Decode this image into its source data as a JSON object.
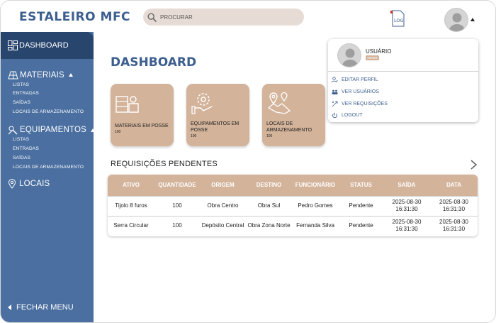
{
  "header": {
    "app_title": "ESTALEIRO MFC",
    "search_placeholder": "PROCURAR",
    "log_label": "LOG"
  },
  "sidebar": {
    "dashboard": "DASHBOARD",
    "materials": {
      "label": "MATERIAIS",
      "items": [
        "LISTAS",
        "ENTRADAS",
        "SAÍDAS",
        "LOCAIS DE ARMAZENAMENTO"
      ]
    },
    "equipment": {
      "label": "EQUIPAMENTOS",
      "items": [
        "LISTAS",
        "ENTRADAS",
        "SAÍDAS",
        "LOCAIS DE ARMAZENAMENTO"
      ]
    },
    "locations": "LOCAIS",
    "close_menu": "FECHAR MENU"
  },
  "main": {
    "title": "DASHBOARD",
    "cards": [
      {
        "title": "MATERIAIS EM POSSE",
        "count": "100",
        "icon": "materials-icon"
      },
      {
        "title": "EQUIPAMENTOS EM POSSE",
        "count": "100",
        "icon": "equipment-icon"
      },
      {
        "title": "LOCAIS DE ARMAZENAMENTO",
        "count": "100",
        "icon": "map-icon"
      }
    ],
    "requests_title": "REQUISIÇÕES PENDENTES",
    "table": {
      "headers": [
        "ATIVO",
        "QUANTIDADE",
        "ORIGEM",
        "DESTINO",
        "FUNCIONÁRIO",
        "STATUS",
        "SAÍDA",
        "DATA"
      ],
      "rows": [
        [
          "Tijolo 8 furos",
          "100",
          "Obra Centro",
          "Obra Sul",
          "Pedro Gomes",
          "Pendente",
          "2025-08-30 16:31:30",
          "2025-08-30 16:31:30"
        ],
        [
          "Serra Circular",
          "100",
          "Depósito Central",
          "Obra Zona Norte",
          "Fernanda Silva",
          "Pendente",
          "2025-08-30 16:31:30",
          "2025-08-30 16:31:30"
        ]
      ]
    }
  },
  "user_menu": {
    "name": "USUÁRIO",
    "role": "ADMIN",
    "items": [
      "EDITAR PERFIL",
      "VER USUÁRIOS",
      "VER REQUISIÇÕES",
      "LOGOUT"
    ]
  },
  "colors": {
    "brand_blue": "#3d5f8f",
    "sidebar_blue": "#4a6fa0",
    "sidebar_active": "#28456e",
    "accent_tan": "#d3b39a",
    "search_bg": "#e7dcd5"
  }
}
